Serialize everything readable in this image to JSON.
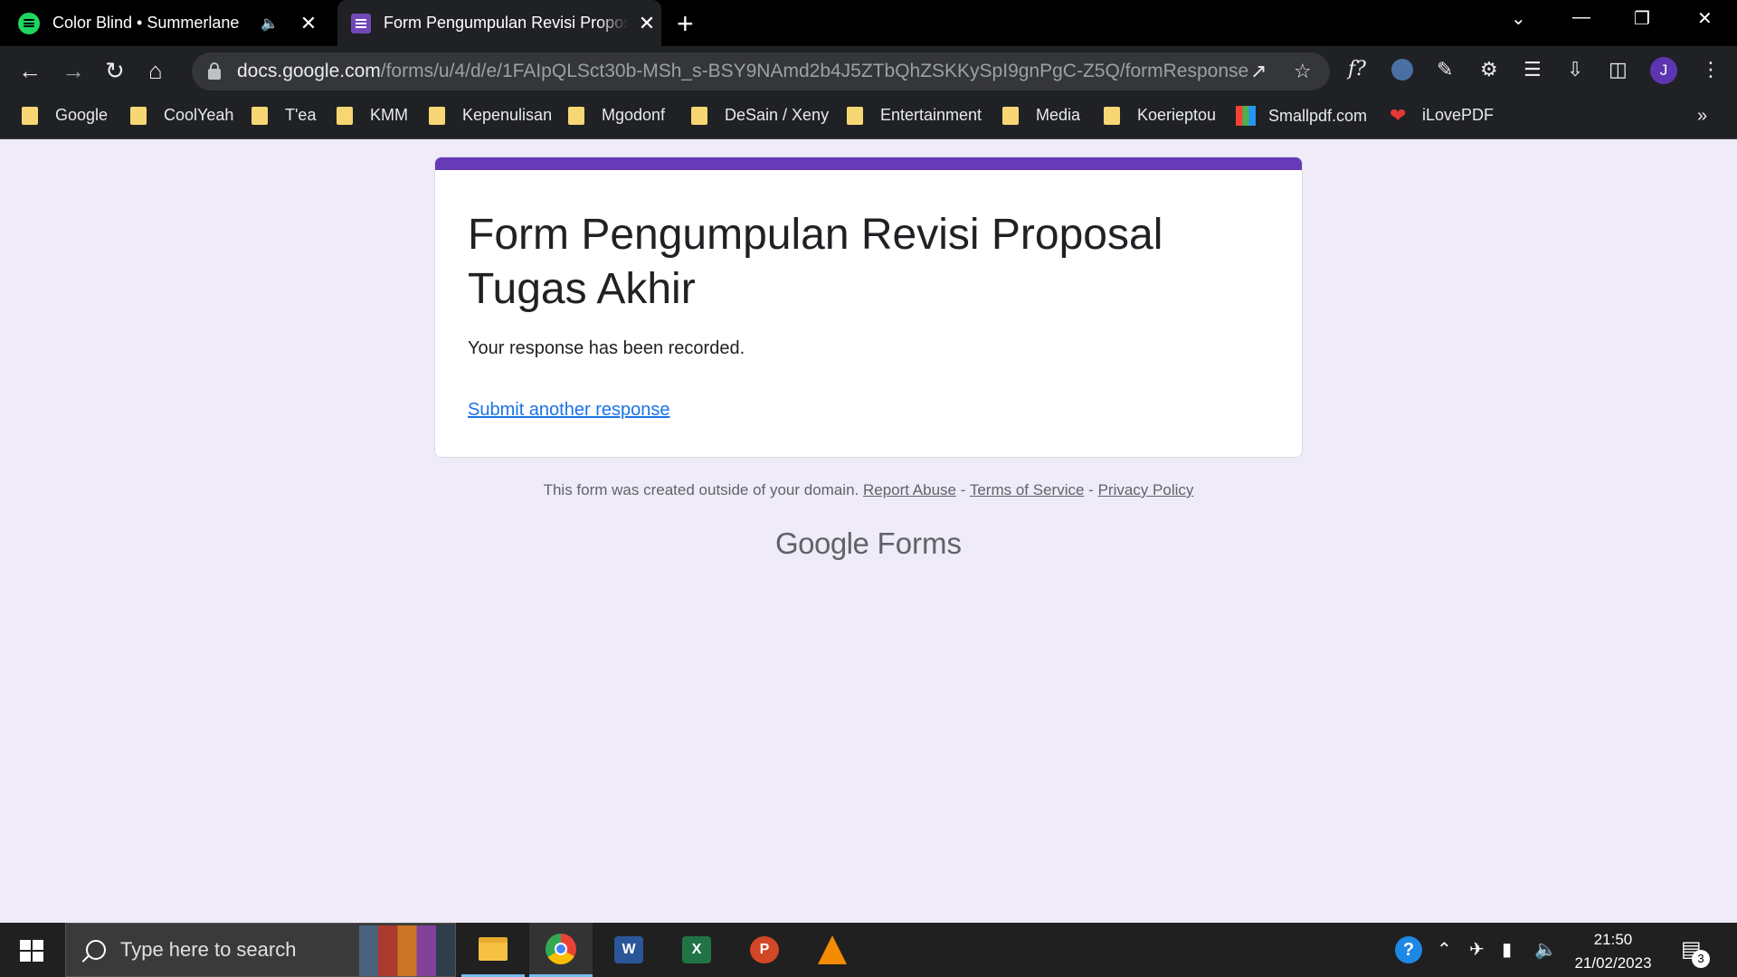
{
  "browser": {
    "tabs": [
      {
        "title": "Color Blind • Summerlane",
        "favicon": "spotify-icon",
        "audio": true
      },
      {
        "title": "Form Pengumpulan Revisi Proposal Tugas Akhir",
        "favicon": "google-forms-icon"
      }
    ],
    "url_host": "docs.google.com",
    "url_path": "/forms/u/4/d/e/1FAIpQLSct30b-MSh_s-BSY9NAmd2b4J5ZTbQhZSKKySpI9gnPgC-Z5Q/formResponse",
    "profile_initial": "J",
    "bookmarks": [
      "Google",
      "CoolYeah",
      "T'ea",
      "KMM",
      "Kepenulisan",
      "Mgodonf",
      "DeSain / Xeny",
      "Entertainment",
      "Media",
      "Koerieptou",
      "Smallpdf.com",
      "iLovePDF"
    ],
    "extension_text": "f?"
  },
  "form": {
    "title": "Form Pengumpulan Revisi Proposal Tugas Akhir",
    "confirmation": "Your response has been recorded.",
    "submit_another": "Submit another response",
    "accent_color": "#673ab7"
  },
  "footer": {
    "notice": "This form was created outside of your domain.",
    "report_abuse": "Report Abuse",
    "separator": "-",
    "terms": "Terms of Service",
    "privacy": "Privacy Policy",
    "brand_google": "Google",
    "brand_forms": "Forms"
  },
  "taskbar": {
    "search_placeholder": "Type here to search",
    "time": "21:50",
    "date": "21/02/2023",
    "notification_count": "3"
  }
}
